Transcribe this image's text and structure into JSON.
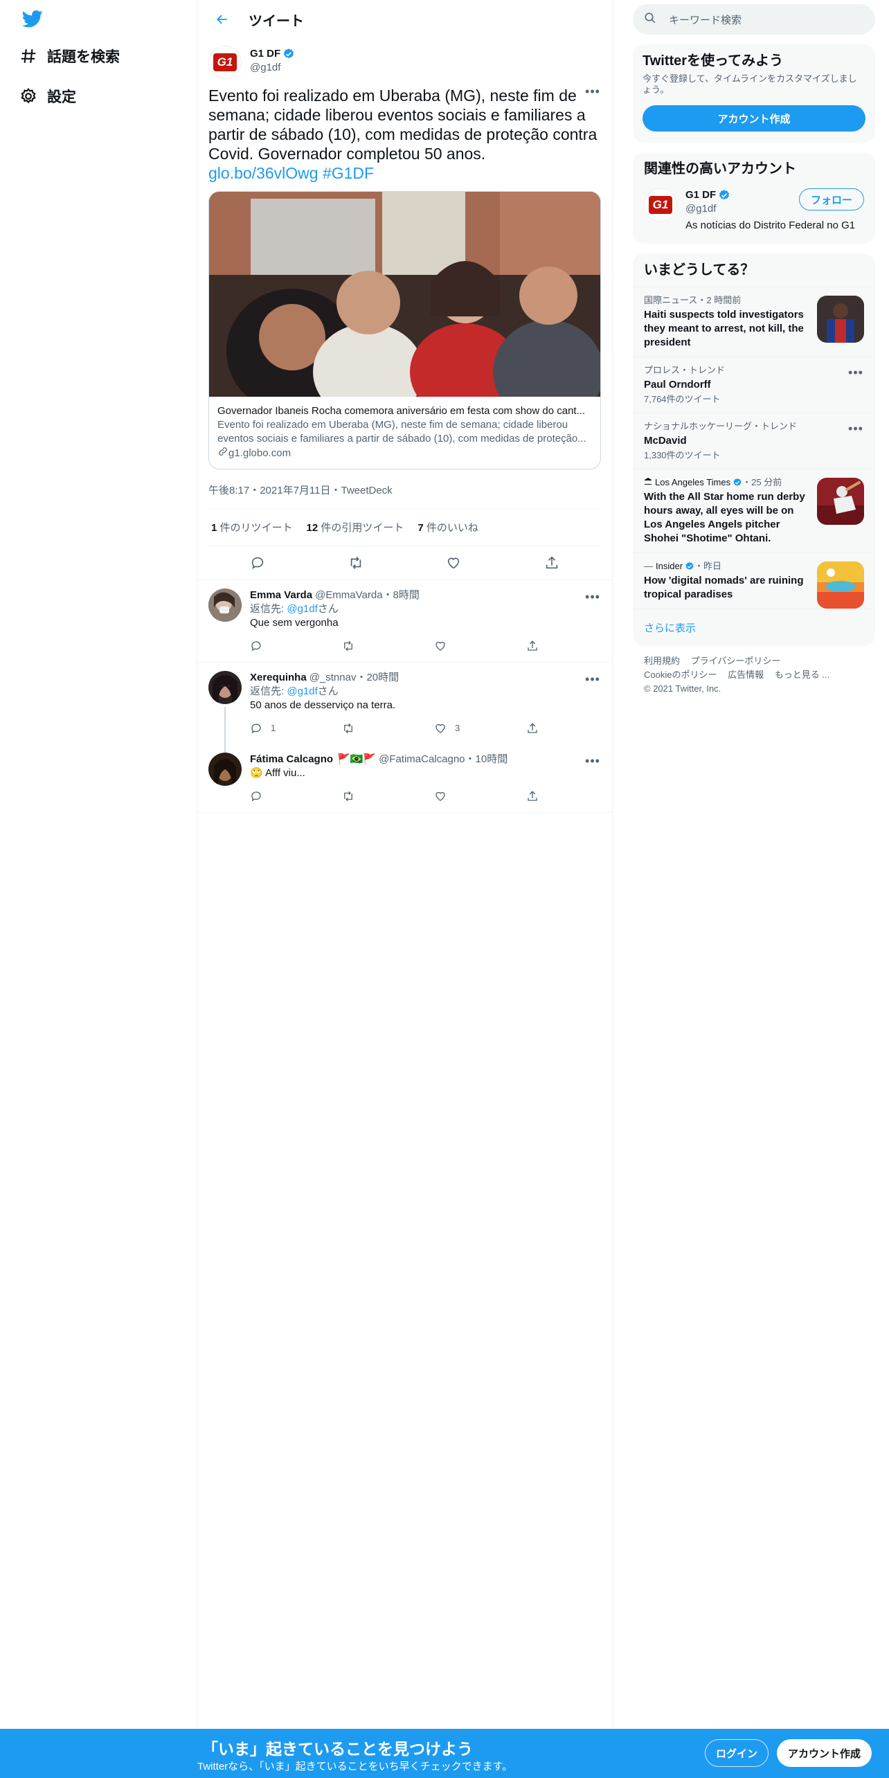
{
  "nav": {
    "explore": "話題を検索",
    "settings": "設定"
  },
  "header": {
    "title": "ツイート"
  },
  "tweet": {
    "name": "G1 DF",
    "handle": "@g1df",
    "avatar_text": "G1",
    "text": "Evento foi realizado em Uberaba (MG), neste fim de semana; cidade liberou eventos sociais e familiares a partir de sábado (10), com medidas de proteção contra Covid. Governador completou 50 anos.",
    "link": "glo.bo/36vlOwg",
    "hashtag": "#G1DF",
    "card": {
      "title": "Governador Ibaneis Rocha comemora aniversário em festa com show do cant...",
      "description": "Evento foi realizado em Uberaba (MG), neste fim de semana; cidade liberou eventos sociais e familiares a partir de sábado (10), com medidas de proteção...",
      "domain": "g1.globo.com"
    },
    "meta": "午後8:17・2021年7月11日・TweetDeck",
    "stats": {
      "retweets_count": "1",
      "retweets_label": "件のリツイート",
      "quotes_count": "12",
      "quotes_label": "件の引用ツイート",
      "likes_count": "7",
      "likes_label": "件のいいね"
    }
  },
  "replies": [
    {
      "name": "Emma Varda",
      "handle": "@EmmaVarda",
      "time": "・8時間",
      "replying_prefix": "返信先: ",
      "replying_to": "@g1df",
      "replying_suffix": "さん",
      "text": "Que sem vergonha",
      "reply_count": "",
      "like_count": ""
    },
    {
      "name": "Xerequinha",
      "handle": "@_stnnav",
      "time": "・20時間",
      "replying_prefix": "返信先: ",
      "replying_to": "@g1df",
      "replying_suffix": "さん",
      "text": "50 anos de desserviço na terra.",
      "reply_count": "1",
      "like_count": "3"
    },
    {
      "name": "Fátima Calcagno",
      "flags": "🚩🇧🇷🚩",
      "handle": "@FatimaCalcagno",
      "time": "・10時間",
      "text": "🙄 Afff viu...",
      "reply_count": "",
      "like_count": ""
    }
  ],
  "search": {
    "placeholder": "キーワード検索"
  },
  "signup_panel": {
    "title": "Twitterを使ってみよう",
    "desc": "今すぐ登録して、タイムラインをカスタマイズしましょう。",
    "button": "アカウント作成"
  },
  "related": {
    "title": "関連性の高いアカウント",
    "name": "G1 DF",
    "handle": "@g1df",
    "bio": "As notícias do Distrito Federal no G1",
    "follow": "フォロー"
  },
  "trends": {
    "title": "いまどうしてる？",
    "items": [
      {
        "meta": "国際ニュース・2 時間前",
        "title": "Haiti suspects told investigators they meant to arrest, not kill, the president",
        "count": ""
      },
      {
        "meta": "プロレス・トレンド",
        "title": "Paul Orndorff",
        "count": "7,764件のツイート"
      },
      {
        "meta": "ナショナルホッケーリーグ・トレンド",
        "title": "McDavid",
        "count": "1,330件のツイート"
      },
      {
        "meta_source": "Los Angeles Times",
        "meta_time": "・25 分前",
        "title": "With the All Star home run derby hours away, all eyes will be on Los Angeles Angels pitcher Shohei \"Shotime\" Ohtani.",
        "count": ""
      },
      {
        "meta_source": "Insider",
        "meta_time": "・昨日",
        "title": "How 'digital nomads' are ruining tropical paradises",
        "count": ""
      }
    ],
    "show_more": "さらに表示"
  },
  "footer": {
    "terms": "利用規約",
    "privacy": "プライバシーポリシー",
    "cookie": "Cookieのポリシー",
    "ads": "広告情報",
    "more": "もっと見る ...",
    "copyright": "© 2021 Twitter, Inc."
  },
  "bottom_bar": {
    "title": "「いま」起きていることを見つけよう",
    "subtitle": "Twitterなら、「いま」起きていることをいち早くチェックできます。",
    "login": "ログイン",
    "signup": "アカウント作成"
  },
  "colors": {
    "accent": "#1d9bf0",
    "text": "#0f1419",
    "secondary": "#536471",
    "g1_red": "#c4170c"
  }
}
